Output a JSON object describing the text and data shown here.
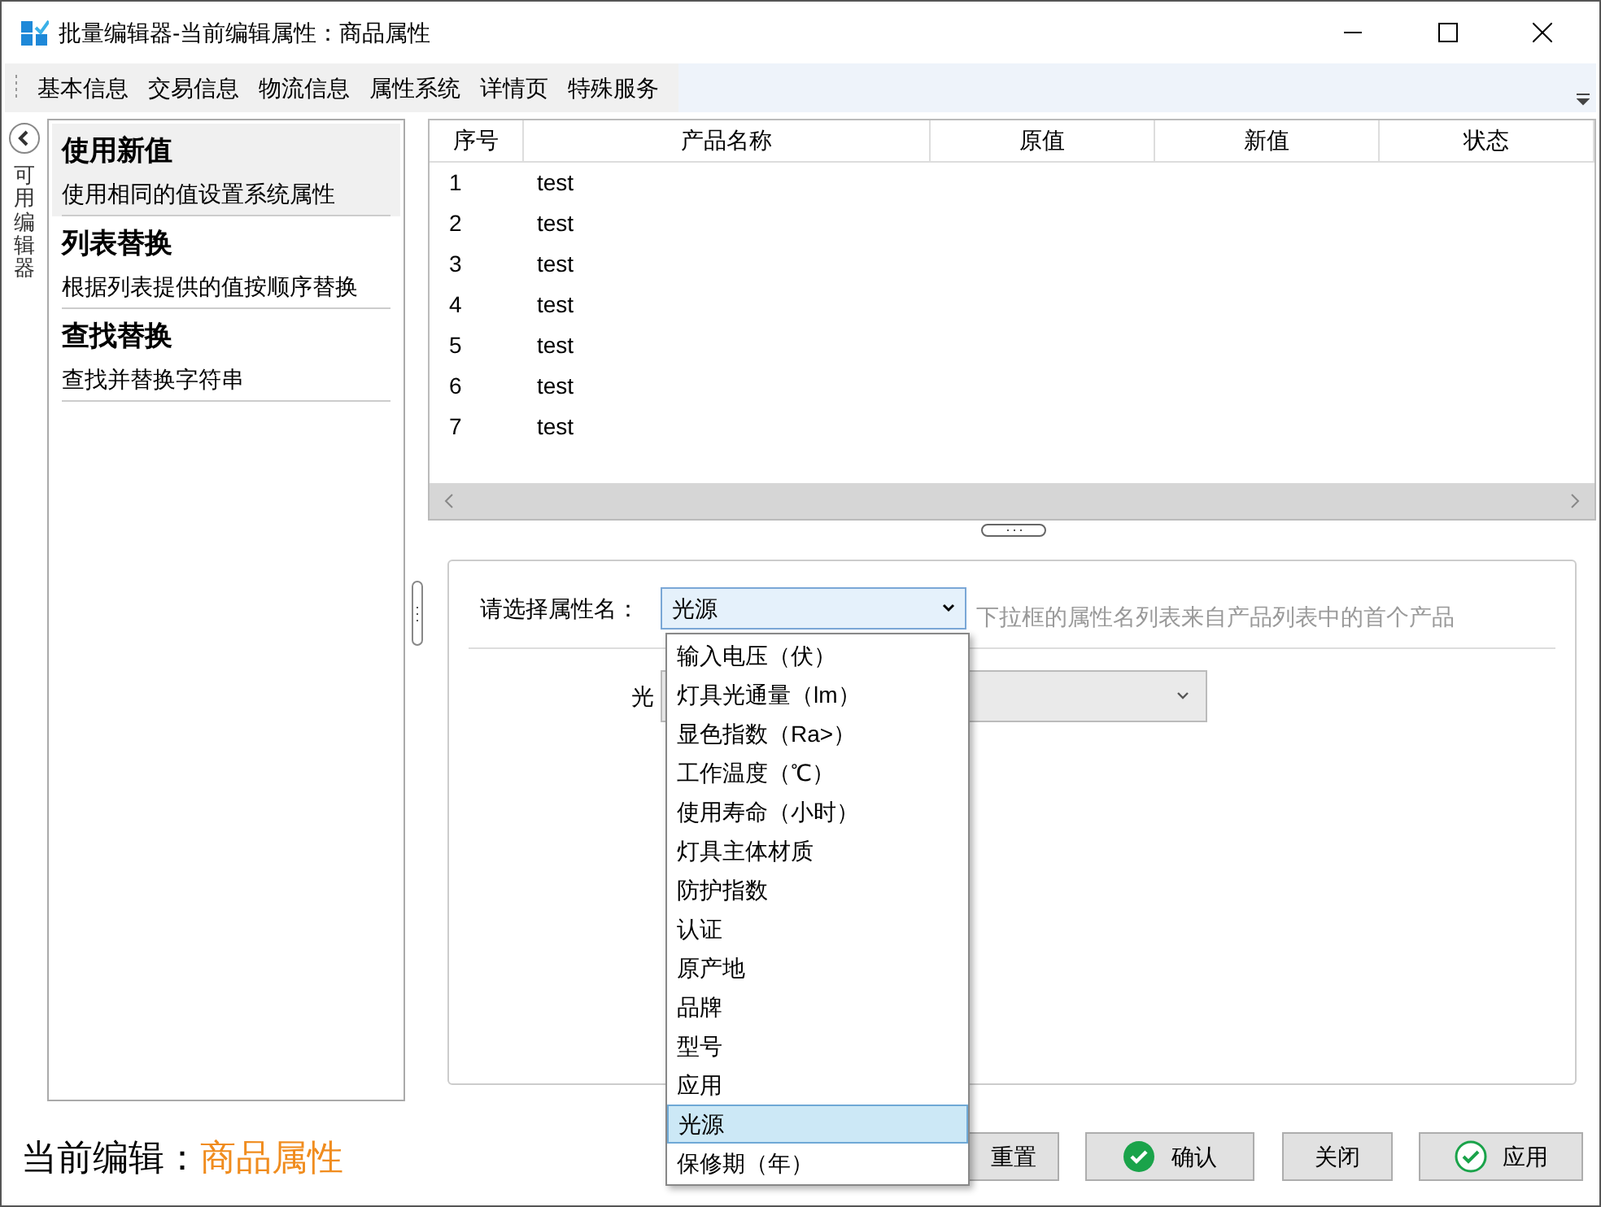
{
  "window": {
    "title": "批量编辑器-当前编辑属性：商品属性"
  },
  "toolbar": [
    {
      "label": "基本信息"
    },
    {
      "label": "交易信息"
    },
    {
      "label": "物流信息"
    },
    {
      "label": "属性系统"
    },
    {
      "label": "详情页"
    },
    {
      "label": "特殊服务"
    }
  ],
  "side_panel": {
    "label": "可用编辑器"
  },
  "editors": [
    {
      "title": "使用新值",
      "description": "使用相同的值设置系统属性",
      "selected": true
    },
    {
      "title": "列表替换",
      "description": "根据列表提供的值按顺序替换",
      "selected": false
    },
    {
      "title": "查找替换",
      "description": "查找并替换字符串",
      "selected": false
    }
  ],
  "table": {
    "columns": [
      "序号",
      "产品名称",
      "原值",
      "新值",
      "状态"
    ],
    "rows": [
      [
        "1",
        "test"
      ],
      [
        "2",
        "test"
      ],
      [
        "3",
        "test"
      ],
      [
        "4",
        "test"
      ],
      [
        "5",
        "test"
      ],
      [
        "6",
        "test"
      ],
      [
        "7",
        "test"
      ]
    ]
  },
  "form": {
    "attribute_label": "请选择属性名：",
    "attribute_value": "光源",
    "hint": "下拉框的属性名列表来自产品列表中的首个产品",
    "value_label": "光",
    "options": [
      {
        "label": "输入电压（伏）",
        "selected": false
      },
      {
        "label": "灯具光通量（lm）",
        "selected": false
      },
      {
        "label": "显色指数（Ra>）",
        "selected": false
      },
      {
        "label": "工作温度（℃）",
        "selected": false
      },
      {
        "label": "使用寿命（小时）",
        "selected": false
      },
      {
        "label": "灯具主体材质",
        "selected": false
      },
      {
        "label": "防护指数",
        "selected": false
      },
      {
        "label": "认证",
        "selected": false
      },
      {
        "label": "原产地",
        "selected": false
      },
      {
        "label": "品牌",
        "selected": false
      },
      {
        "label": "型号",
        "selected": false
      },
      {
        "label": "应用",
        "selected": false
      },
      {
        "label": "光源",
        "selected": true
      },
      {
        "label": "保修期（年）",
        "selected": false
      }
    ]
  },
  "footer": {
    "label": "当前编辑：",
    "value": "商品属性",
    "buttons": [
      {
        "label": "重置",
        "kind": "plain"
      },
      {
        "label": "确认",
        "kind": "check-filled"
      },
      {
        "label": "关闭",
        "kind": "plain"
      },
      {
        "label": "应用",
        "kind": "check-outline"
      }
    ]
  }
}
